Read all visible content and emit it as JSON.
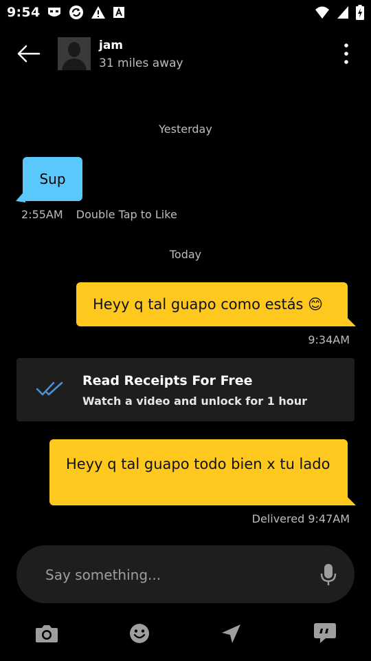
{
  "status_bar": {
    "time": "9:54",
    "left_icons": [
      "grindr-mask-icon",
      "sync-icon",
      "warning-icon",
      "a-box-icon"
    ],
    "right_icons": [
      "wifi-icon",
      "cell-signal-icon",
      "battery-icon"
    ]
  },
  "header": {
    "name": "jam",
    "distance": "31 miles away",
    "back_icon": "arrow-left-icon",
    "more_icon": "more-vertical-icon"
  },
  "conversation": {
    "day_yesterday": "Yesterday",
    "incoming": {
      "text": "Sup",
      "time": "2:55AM",
      "hint": "Double Tap to Like"
    },
    "day_today": "Today",
    "outgoing_1": {
      "text": "Heyy q tal guapo como estás 😊",
      "time": "9:34AM"
    },
    "read_receipts": {
      "title": "Read Receipts For Free",
      "subtitle": "Watch a video and unlock for 1 hour"
    },
    "outgoing_2": {
      "text": "Heyy q tal guapo todo bien x tu lado",
      "status": "Delivered 9:47AM"
    }
  },
  "composer": {
    "placeholder": "Say something..."
  },
  "bottom_bar": [
    "camera-icon",
    "emoji-icon",
    "send-location-icon",
    "saved-phrases-icon"
  ],
  "colors": {
    "background": "#000000",
    "incoming_bubble": "#5ac8fa",
    "outgoing_bubble": "#ffc81e",
    "card": "#1e1e1e",
    "check_blue": "#4a90d9"
  }
}
